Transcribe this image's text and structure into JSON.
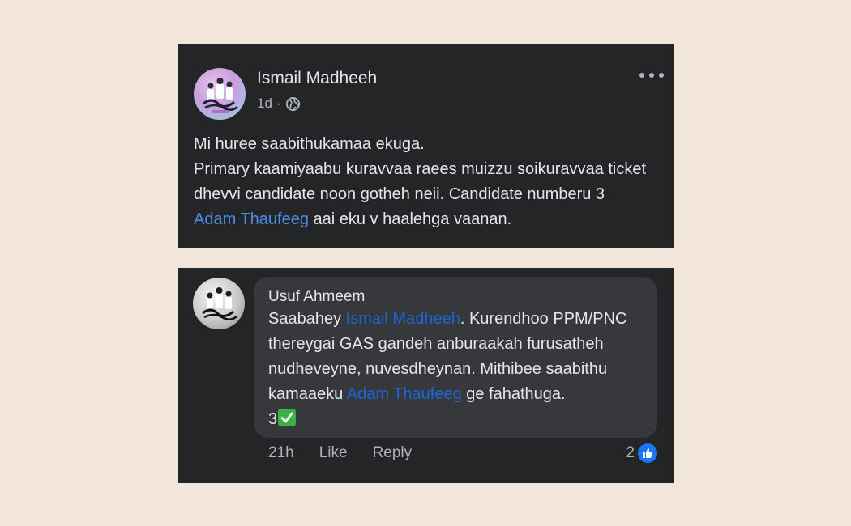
{
  "post": {
    "author": "Ismail Madheeh",
    "time": "1d",
    "separator": "·",
    "privacy_icon": "globe-icon",
    "more_icon": "more-options-icon",
    "line1": "Mi huree saabithukamaa ekuga.",
    "line2": "Primary kaamiyaabu kuravvaa raees muizzu soikuravvaa ticket dhevvi candidate noon gotheh neii. Candidate numberu 3",
    "mention": "Adam Thaufeeg",
    "line2_end": " aai eku v haalehga vaanan."
  },
  "comment": {
    "author": "Usuf Ahmeem",
    "text_start": "Saabahey ",
    "mention1": "Ismail Madheeh",
    "text_mid": ". Kurendhoo PPM/PNC thereygai GAS gandeh anburaakah furusatheh nudheveyne, nuvesdheynan. Mithibee saabithu kamaaeku ",
    "mention2": "Adam Thaufeeg",
    "text_end": " ge fahathuga.",
    "last_line": "3",
    "emoji": "check-mark-icon",
    "time": "21h",
    "like_label": "Like",
    "reply_label": "Reply",
    "reaction_count": "2",
    "reaction_icon": "thumbs-up-icon"
  },
  "colors": {
    "page_bg": "#f2e5d9",
    "card_bg": "#232527",
    "bubble_bg": "#36383b",
    "link_post": "#4b8ee8",
    "link_comment": "#1a66d6",
    "like_blue": "#1877f2",
    "check_green": "#3cb043"
  }
}
